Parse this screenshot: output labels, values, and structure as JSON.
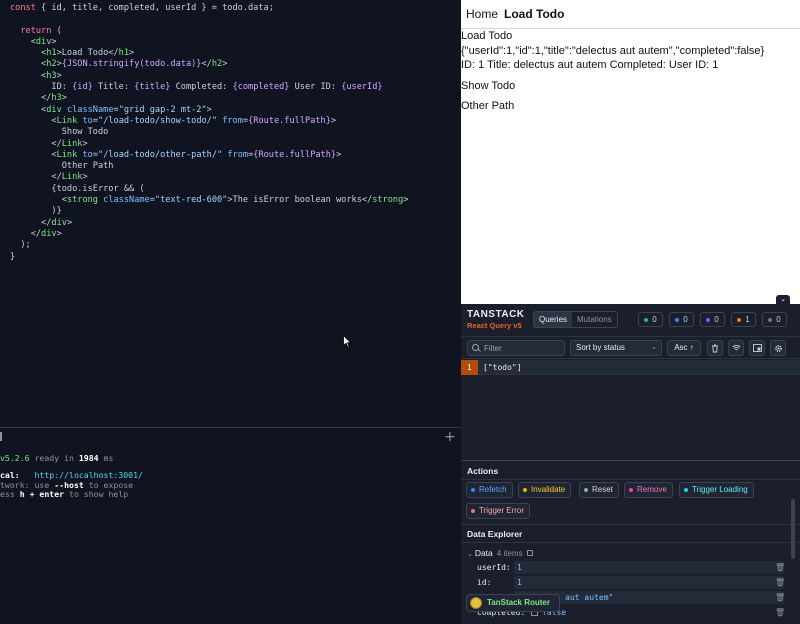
{
  "editor": {
    "lines": [
      [
        [
          "k",
          "const "
        ],
        [
          "p",
          "{ id, title, completed, userId } = todo.data;"
        ]
      ],
      [],
      [
        [
          "p",
          "  "
        ],
        [
          "k",
          "return"
        ],
        [
          "p",
          " ("
        ]
      ],
      [
        [
          "p",
          "    <"
        ],
        [
          "t",
          "div"
        ],
        [
          "p",
          ">"
        ]
      ],
      [
        [
          "p",
          "      <"
        ],
        [
          "t",
          "h1"
        ],
        [
          "p",
          ">Load Todo</"
        ],
        [
          "t",
          "h1"
        ],
        [
          "p",
          ">"
        ]
      ],
      [
        [
          "p",
          "      <"
        ],
        [
          "t",
          "h2"
        ],
        [
          "p",
          ">"
        ],
        [
          "e",
          "{JSON.stringify(todo.data)}"
        ],
        [
          "p",
          "</"
        ],
        [
          "t",
          "h2"
        ],
        [
          "p",
          ">"
        ]
      ],
      [
        [
          "p",
          "      <"
        ],
        [
          "t",
          "h3"
        ],
        [
          "p",
          ">"
        ]
      ],
      [
        [
          "p",
          "        ID: "
        ],
        [
          "e",
          "{id}"
        ],
        [
          "p",
          " Title: "
        ],
        [
          "e",
          "{title}"
        ],
        [
          "p",
          " Completed: "
        ],
        [
          "e",
          "{completed}"
        ],
        [
          "p",
          " User ID: "
        ],
        [
          "e",
          "{userId}"
        ]
      ],
      [
        [
          "p",
          "      </"
        ],
        [
          "t",
          "h3"
        ],
        [
          "p",
          ">"
        ]
      ],
      [
        [
          "p",
          "      <"
        ],
        [
          "t",
          "div"
        ],
        [
          "p",
          " "
        ],
        [
          "a",
          "className"
        ],
        [
          "p",
          "="
        ],
        [
          "s",
          "\"grid gap-2 mt-2\""
        ],
        [
          "p",
          ">"
        ]
      ],
      [
        [
          "p",
          "        <"
        ],
        [
          "t",
          "Link"
        ],
        [
          "p",
          " "
        ],
        [
          "a",
          "to"
        ],
        [
          "p",
          "="
        ],
        [
          "s",
          "\"/load-todo/show-todo/\""
        ],
        [
          "p",
          " "
        ],
        [
          "a",
          "from"
        ],
        [
          "p",
          "="
        ],
        [
          "e",
          "{Route.fullPath}"
        ],
        [
          "p",
          ">"
        ]
      ],
      [
        [
          "p",
          "          Show Todo"
        ]
      ],
      [
        [
          "p",
          "        </"
        ],
        [
          "t",
          "Link"
        ],
        [
          "p",
          ">"
        ]
      ],
      [
        [
          "p",
          "        <"
        ],
        [
          "t",
          "Link"
        ],
        [
          "p",
          " "
        ],
        [
          "a",
          "to"
        ],
        [
          "p",
          "="
        ],
        [
          "s",
          "\"/load-todo/other-path/\""
        ],
        [
          "p",
          " "
        ],
        [
          "a",
          "from"
        ],
        [
          "p",
          "="
        ],
        [
          "e",
          "{Route.fullPath}"
        ],
        [
          "p",
          ">"
        ]
      ],
      [
        [
          "p",
          "          Other Path"
        ]
      ],
      [
        [
          "p",
          "        </"
        ],
        [
          "t",
          "Link"
        ],
        [
          "p",
          ">"
        ]
      ],
      [
        [
          "p",
          "        {todo.isError && ("
        ]
      ],
      [
        [
          "p",
          "          <"
        ],
        [
          "t",
          "strong"
        ],
        [
          "p",
          " "
        ],
        [
          "a",
          "className"
        ],
        [
          "p",
          "="
        ],
        [
          "s",
          "\"text-red-600\""
        ],
        [
          "p",
          ">The isError boolean works</"
        ],
        [
          "t",
          "strong"
        ],
        [
          "p",
          ">"
        ]
      ],
      [
        [
          "p",
          "        )}"
        ]
      ],
      [
        [
          "p",
          "      </"
        ],
        [
          "t",
          "div"
        ],
        [
          "p",
          ">"
        ]
      ],
      [
        [
          "p",
          "    </"
        ],
        [
          "t",
          "div"
        ],
        [
          "p",
          ">"
        ]
      ],
      [
        [
          "p",
          "  );"
        ]
      ],
      [
        [
          "p",
          "}"
        ]
      ]
    ]
  },
  "terminal": {
    "version": "v5.2.6",
    "ready_text": "  ready in ",
    "ready_ms": "1984",
    "ready_unit": " ms",
    "local_label": "cal:",
    "local_url": "http://localhost:3001/",
    "network_label": "twork: use ",
    "network_flag": "--host",
    "network_rest": " to expose",
    "help_prefix": "ess ",
    "help_key": "h + enter",
    "help_rest": " to show help",
    "plus": "+"
  },
  "app": {
    "nav_home": "Home",
    "nav_active": "Load Todo",
    "h1": "Load Todo",
    "h2": "{\"userId\":1,\"id\":1,\"title\":\"delectus aut autem\",\"completed\":false}",
    "h3": "ID: 1 Title: delectus aut autem Completed: User ID: 1",
    "link1": "Show Todo",
    "link2": "Other Path"
  },
  "devtools": {
    "logo_top": "TANSTACK",
    "logo_bottom": "React Query v5",
    "tabs": [
      "Queries",
      "Mutations"
    ],
    "counts": [
      {
        "value": "0",
        "color": "#22c55e"
      },
      {
        "value": "0",
        "color": "#3b82f6"
      },
      {
        "value": "0",
        "color": "#6366f1"
      },
      {
        "value": "1",
        "color": "#f97316"
      },
      {
        "value": "0",
        "color": "#6b7280"
      }
    ],
    "filter_placeholder": "Filter",
    "sort_label": "Sort by status",
    "asc_label": "Asc ↑",
    "query_count": "1",
    "query_key": "[\"todo\"]",
    "actions_title": "Actions",
    "actions": [
      {
        "label": "Refetch",
        "color": "#3b82f6"
      },
      {
        "label": "Invalidate",
        "color": "#eab308"
      },
      {
        "label": "Reset",
        "color": "#9ca3af"
      },
      {
        "label": "Remove",
        "color": "#ec4899"
      },
      {
        "label": "Trigger Loading",
        "color": "#22d3ee"
      },
      {
        "label": "Trigger Error",
        "color": "#f87171"
      }
    ],
    "data_explorer_title": "Data Explorer",
    "data_label": "Data",
    "data_items": "4 items",
    "rows": [
      {
        "key": "userId:",
        "value": "1"
      },
      {
        "key": "id:",
        "value": "1"
      },
      {
        "key": "title:",
        "value": "\"delectus aut autem\""
      },
      {
        "key": "completed:",
        "value": "false"
      }
    ],
    "router_label": "TanStack Router"
  }
}
